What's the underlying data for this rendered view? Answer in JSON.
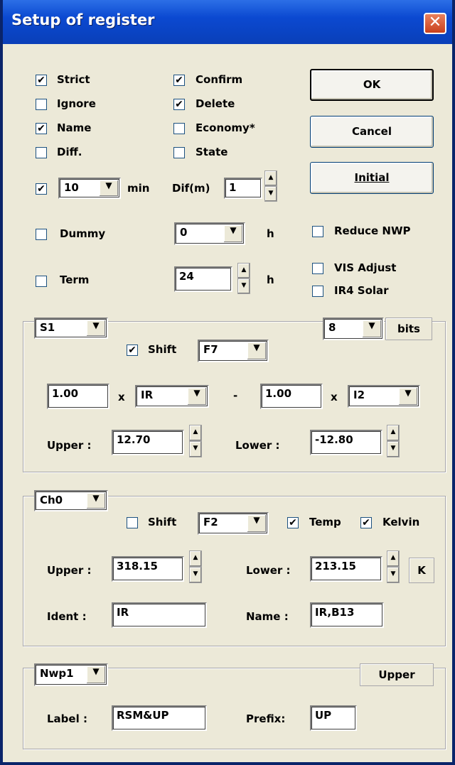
{
  "window": {
    "title": "Setup of register",
    "close_glyph": "✕"
  },
  "top": {
    "strict": {
      "label": "Strict",
      "checked": true
    },
    "ignore": {
      "label": "Ignore",
      "checked": false
    },
    "name": {
      "label": "Name",
      "checked": true
    },
    "diff": {
      "label": "Diff.",
      "checked": false
    },
    "confirm": {
      "label": "Confirm",
      "checked": true
    },
    "delete": {
      "label": "Delete",
      "checked": true
    },
    "economy": {
      "label": "Economy*",
      "checked": false
    },
    "state": {
      "label": "State",
      "checked": false
    },
    "interval_enabled": true,
    "interval_value": "10",
    "interval_unit": "min",
    "dif_label": "Dif(m)",
    "dif_value": "1",
    "dummy": {
      "label": "Dummy",
      "checked": false
    },
    "dummy_value": "0",
    "dummy_unit": "h",
    "term": {
      "label": "Term",
      "checked": false
    },
    "term_value": "24",
    "term_unit": "h",
    "reduce_nwp": {
      "label": "Reduce NWP",
      "checked": false
    },
    "vis_adjust": {
      "label": "VIS Adjust",
      "checked": false
    },
    "ir4_solar": {
      "label": "IR4 Solar",
      "checked": false
    }
  },
  "buttons": {
    "ok": "OK",
    "cancel": "Cancel",
    "initial": "Initial"
  },
  "group_s": {
    "select": "S1",
    "bits_value": "8",
    "bits_label": "bits",
    "shift": {
      "label": "Shift",
      "checked": true
    },
    "shift_key": "F7",
    "coef1": "1.00",
    "x1": "x",
    "band1": "IR",
    "minus": "-",
    "coef2": "1.00",
    "x2": "x",
    "band2": "I2",
    "upper_label": "Upper :",
    "upper_value": "12.70",
    "lower_label": "Lower :",
    "lower_value": "-12.80"
  },
  "group_ch": {
    "select": "Ch0",
    "shift": {
      "label": "Shift",
      "checked": false
    },
    "shift_key": "F2",
    "temp": {
      "label": "Temp",
      "checked": true
    },
    "kelvin": {
      "label": "Kelvin",
      "checked": true
    },
    "upper_label": "Upper :",
    "upper_value": "318.15",
    "lower_label": "Lower :",
    "lower_value": "213.15",
    "unit": "K",
    "ident_label": "Ident :",
    "ident_value": "IR",
    "name_label": "Name :",
    "name_value": "IR,B13"
  },
  "group_nwp": {
    "select": "Nwp1",
    "upper_label": "Upper",
    "label_label": "Label :",
    "label_value": "RSM&UP",
    "prefix_label": "Prefix:",
    "prefix_value": "UP"
  }
}
